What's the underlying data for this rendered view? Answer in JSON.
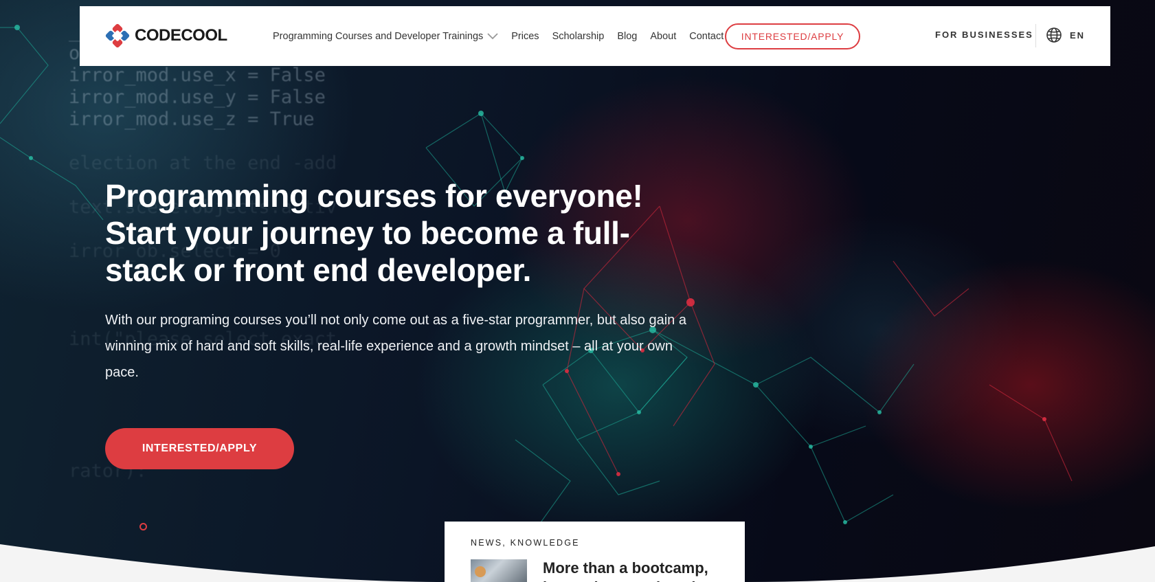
{
  "brand": {
    "name": "CODECOOL",
    "accent_color": "#dd3d41",
    "logo_icon": "codecool-logo-icon"
  },
  "nav": {
    "items": [
      {
        "label": "Programming Courses and Developer Trainings",
        "has_dropdown": true
      },
      {
        "label": "Prices"
      },
      {
        "label": "Scholarship"
      },
      {
        "label": "Blog"
      },
      {
        "label": "About"
      },
      {
        "label": "Contact"
      }
    ],
    "cta_label": "INTERESTED/APPLY",
    "for_businesses": "FOR BUSINESSES",
    "language": "EN",
    "language_icon": "globe-icon"
  },
  "hero": {
    "title_lines": [
      "Programming courses for everyone!",
      "Start your journey to become a full-",
      "stack or front end developer."
    ],
    "description": "With our programing courses you’ll not only come out as a five-star programmer, but also gain a winning mix of hard and soft skills, real-life experience and a growth mindset – all at your own pace.",
    "cta_label": "INTERESTED/APPLY",
    "code_lines": [
      "_mirror_mod.use_x = False",
      "operation == \"MIRROR_Z\"",
      "irror_mod.use_x = False",
      "irror_mod.use_y = False",
      "irror_mod.use_z = True",
      "",
      "election at the end -add",
      "",
      "text.scene.objects.activ",
      "",
      "irror_ob.select = 0",
      "",
      "",
      "",
      "int(\"please select exact",
      "",
      "",
      "",
      "",
      "",
      "rator):"
    ]
  },
  "news": {
    "label": "NEWS, KNOWLEDGE",
    "title": "More than a bootcamp, better than a university"
  }
}
